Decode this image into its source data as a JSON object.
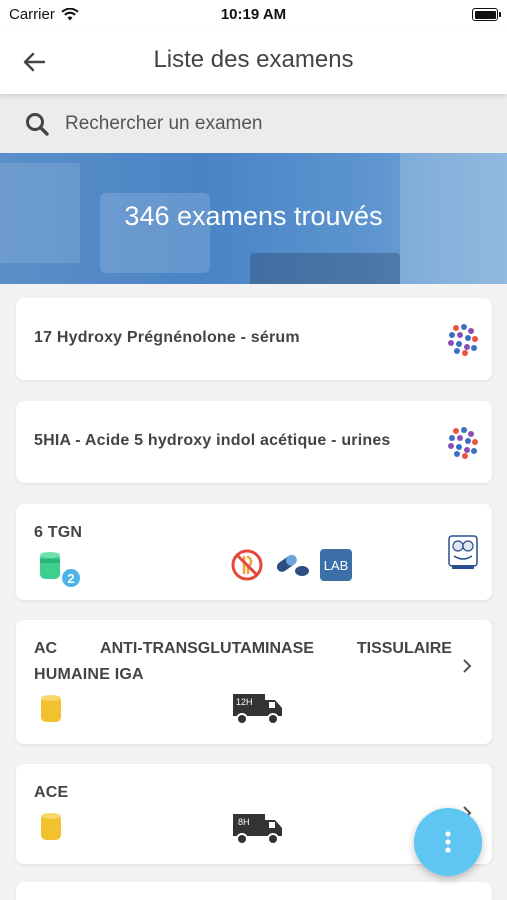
{
  "status_bar": {
    "carrier": "Carrier",
    "time": "10:19 AM"
  },
  "header": {
    "title": "Liste des examens"
  },
  "search": {
    "placeholder": "Rechercher un examen"
  },
  "banner": {
    "text": "346 examens trouvés"
  },
  "exams": [
    {
      "title": "17 Hydroxy Prégnénolone - sérum",
      "lab_logo": "dots-lab-logo"
    },
    {
      "title": "5HIA - Acide 5 hydroxy indol acétique - urines",
      "lab_logo": "dots-lab-logo"
    },
    {
      "title": "6 TGN",
      "tube_count": "2",
      "icons": [
        "no-food-icon",
        "medication-icon",
        "lab-badge-icon"
      ],
      "lab_badge": "LAB",
      "lab_logo": "mascot-lab-logo"
    },
    {
      "title_line1": [
        "AC",
        "ANTI-TRANSGLUTAMINASE",
        "TISSULAIRE"
      ],
      "title_line2": "HUMAINE IGA",
      "delivery": "12H"
    },
    {
      "title": "ACE",
      "delivery": "8H"
    }
  ],
  "colors": {
    "accent": "#5ec6f0",
    "banner": "#4a84c6",
    "tube_green": "#3ecf8e",
    "tube_yellow": "#f2c12e"
  }
}
